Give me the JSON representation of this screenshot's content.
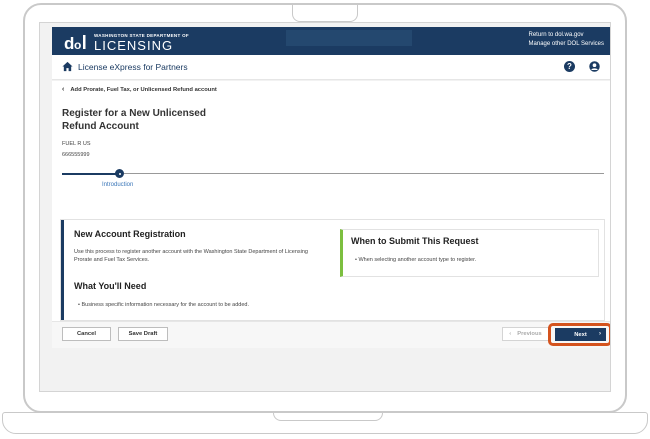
{
  "header": {
    "agency_small": "WASHINGTON STATE DEPARTMENT OF",
    "agency_big": "LICENSING",
    "link_return": "Return to dol.wa.gov",
    "link_manage": "Manage other DOL Services"
  },
  "subbar": {
    "title": "License eXpress for Partners",
    "help_glyph": "?"
  },
  "breadcrumb": {
    "back_glyph": "‹",
    "label": "Add Prorate, Fuel Tax, or Unlicensed Refund account"
  },
  "page": {
    "title": "Register for a New Unlicensed Refund Account",
    "account_name": "FUEL R US",
    "account_number": "666555999"
  },
  "stepper": {
    "current_step": "Introduction"
  },
  "content": {
    "new_account_heading": "New Account Registration",
    "new_account_text": "Use this process to register another account with the Washington State Department of Licensing Prorate and Fuel Tax Services.",
    "need_heading": "What You'll Need",
    "need_item": "Business specific information necessary for the account to be added.",
    "when_heading": "When to Submit This Request",
    "when_item": "When selecting another account type to register."
  },
  "footer": {
    "cancel_label": "Cancel",
    "save_draft_label": "Save Draft",
    "previous_label": "Previous",
    "next_label": "Next",
    "prev_glyph": "‹",
    "next_glyph": "›"
  },
  "colors": {
    "brand_navy": "#1b3b62",
    "accent_green": "#7cbf3f",
    "highlight_orange": "#d4531e",
    "step_blue": "#3a76b8"
  }
}
